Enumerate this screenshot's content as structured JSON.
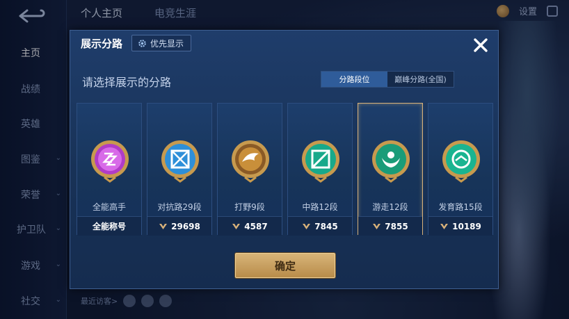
{
  "background": {
    "nav_items": [
      {
        "label": "主页",
        "active": true
      },
      {
        "label": "战绩"
      },
      {
        "label": "英雄"
      },
      {
        "label": "图鉴"
      },
      {
        "label": "荣誉"
      },
      {
        "label": "护卫队"
      },
      {
        "label": "游戏"
      },
      {
        "label": "社交"
      }
    ],
    "top_tabs": [
      "个人主页",
      "电竞生涯"
    ],
    "settings_label": "设置",
    "visitors_label": "最近访客>"
  },
  "modal": {
    "title": "展示分路",
    "priority_label": "优先显示",
    "subtitle": "请选择展示的分路",
    "segments": [
      "分路段位",
      "巅峰分路(全国)"
    ],
    "active_segment": 0,
    "confirm_label": "确定",
    "cards": [
      {
        "label": "全能高手",
        "footer": "全能称号",
        "score": null,
        "selected": false,
        "color": "#b03cc8"
      },
      {
        "label": "对抗路29段",
        "footer": "29698",
        "score": "29698",
        "selected": false,
        "color": "#2e8fd8"
      },
      {
        "label": "打野9段",
        "footer": "4587",
        "score": "4587",
        "selected": false,
        "color": "#c98f3a"
      },
      {
        "label": "中路12段",
        "footer": "7845",
        "score": "7845",
        "selected": false,
        "color": "#18a98a"
      },
      {
        "label": "游走12段",
        "footer": "7855",
        "score": "7855",
        "selected": true,
        "color": "#1a9c78"
      },
      {
        "label": "发育路15段",
        "footer": "10189",
        "score": "10189",
        "selected": false,
        "color": "#1ab490"
      }
    ]
  },
  "colors": {
    "accent_gold": "#d9b27a",
    "panel_blue": "#1f3d6b",
    "segment_active": "#2f5c9a"
  }
}
